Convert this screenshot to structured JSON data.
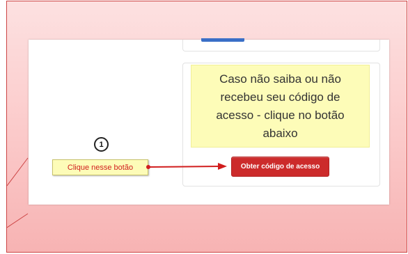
{
  "info": {
    "text": "Caso não saiba ou não recebeu seu código de acesso - clique no botão abaixo"
  },
  "action": {
    "button_label": "Obter código de acesso"
  },
  "annotation": {
    "step_number": "1",
    "note": "Clique nesse botão"
  },
  "colors": {
    "callout_bg": "#fbc9c9",
    "info_bg": "#fdfcb8",
    "button_bg": "#cc2b2b",
    "note_text": "#d11d1d"
  }
}
